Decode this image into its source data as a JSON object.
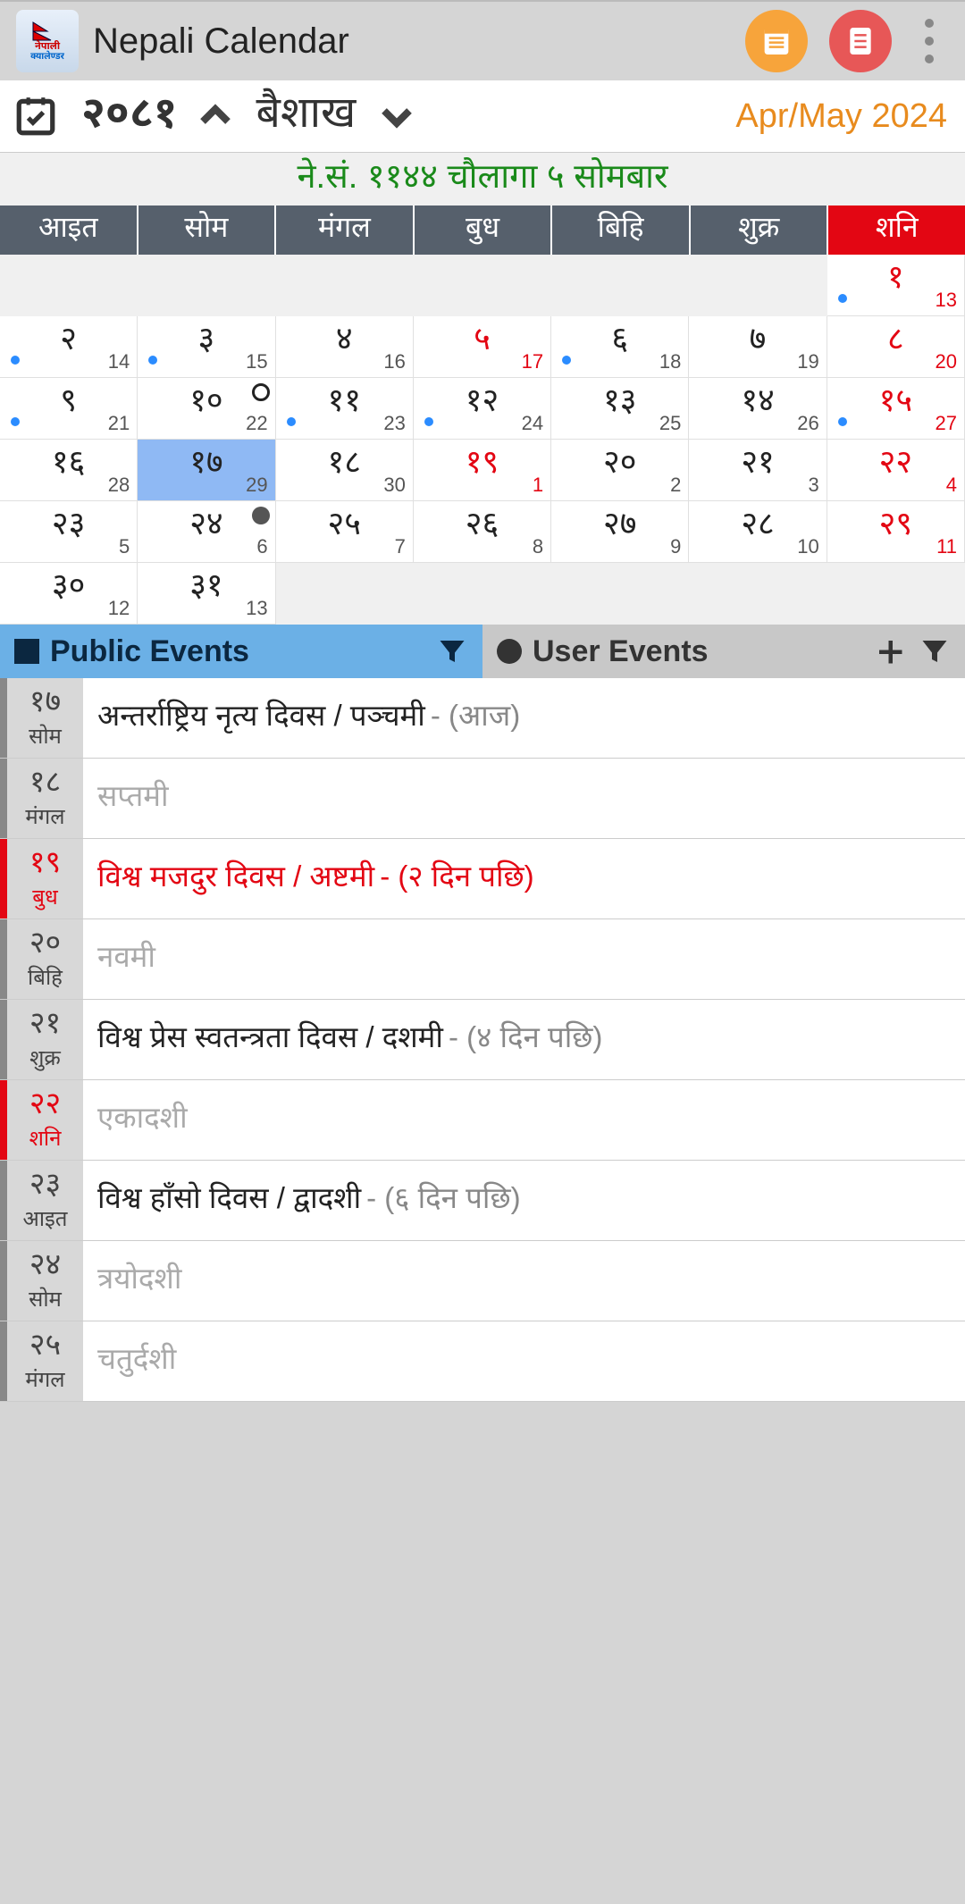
{
  "header": {
    "title": "Nepali Calendar"
  },
  "nav": {
    "year": "२०८१",
    "month": "बैशाख",
    "eng": "Apr/May 2024"
  },
  "subtitle": "ने.सं. ११४४ चौलागा ५ सोमबार",
  "weekdays": [
    "आइत",
    "सोम",
    "मंगल",
    "बुध",
    "बिहि",
    "शुक्र",
    "शनि"
  ],
  "rows": [
    [
      null,
      null,
      null,
      null,
      null,
      null,
      {
        "np": "१",
        "en": "13",
        "red": true,
        "dot": true
      }
    ],
    [
      {
        "np": "२",
        "en": "14",
        "dot": true
      },
      {
        "np": "३",
        "en": "15",
        "dot": true
      },
      {
        "np": "४",
        "en": "16"
      },
      {
        "np": "५",
        "en": "17",
        "red": true
      },
      {
        "np": "६",
        "en": "18",
        "dot": true
      },
      {
        "np": "७",
        "en": "19"
      },
      {
        "np": "८",
        "en": "20",
        "red": true
      }
    ],
    [
      {
        "np": "९",
        "en": "21",
        "dot": true
      },
      {
        "np": "१०",
        "en": "22",
        "moon": "open"
      },
      {
        "np": "११",
        "en": "23",
        "dot": true
      },
      {
        "np": "१२",
        "en": "24",
        "dot": true
      },
      {
        "np": "१३",
        "en": "25"
      },
      {
        "np": "१४",
        "en": "26"
      },
      {
        "np": "१५",
        "en": "27",
        "red": true,
        "dot": true
      }
    ],
    [
      {
        "np": "१६",
        "en": "28"
      },
      {
        "np": "१७",
        "en": "29",
        "today": true
      },
      {
        "np": "१८",
        "en": "30"
      },
      {
        "np": "१९",
        "en": "1",
        "red": true
      },
      {
        "np": "२०",
        "en": "2"
      },
      {
        "np": "२१",
        "en": "3"
      },
      {
        "np": "२२",
        "en": "4",
        "red": true
      }
    ],
    [
      {
        "np": "२३",
        "en": "5"
      },
      {
        "np": "२४",
        "en": "6",
        "moon": "full"
      },
      {
        "np": "२५",
        "en": "7"
      },
      {
        "np": "२६",
        "en": "8"
      },
      {
        "np": "२७",
        "en": "9"
      },
      {
        "np": "२८",
        "en": "10"
      },
      {
        "np": "२९",
        "en": "11",
        "red": true
      }
    ],
    [
      {
        "np": "३०",
        "en": "12"
      },
      {
        "np": "३१",
        "en": "13"
      },
      null,
      null,
      null,
      null,
      null
    ]
  ],
  "ev_header": {
    "public": "Public Events",
    "user": "User Events"
  },
  "events": [
    {
      "d": "१७",
      "w": "सोम",
      "red": false,
      "txt": "अन्तर्राष्ट्रिय नृत्य दिवस / पञ्चमी",
      "sfx": " - (आज)",
      "style": "bold"
    },
    {
      "d": "१८",
      "w": "मंगल",
      "red": false,
      "txt": "सप्तमी",
      "sfx": "",
      "style": "past"
    },
    {
      "d": "१९",
      "w": "बुध",
      "red": true,
      "txt": "विश्व मजदुर दिवस / अष्टमी",
      "sfx": " - (२ दिन पछि)",
      "style": "red"
    },
    {
      "d": "२०",
      "w": "बिहि",
      "red": false,
      "txt": "नवमी",
      "sfx": "",
      "style": "past"
    },
    {
      "d": "२१",
      "w": "शुक्र",
      "red": false,
      "txt": "विश्व प्रेस स्वतन्त्रता दिवस / दशमी",
      "sfx": " - (४ दिन पछि)",
      "style": "bold"
    },
    {
      "d": "२२",
      "w": "शनि",
      "red": true,
      "txt": "एकादशी",
      "sfx": "",
      "style": "past"
    },
    {
      "d": "२३",
      "w": "आइत",
      "red": false,
      "txt": "विश्व हाँसो दिवस / द्वादशी",
      "sfx": " - (६ दिन पछि)",
      "style": "bold"
    },
    {
      "d": "२४",
      "w": "सोम",
      "red": false,
      "txt": "त्रयोदशी",
      "sfx": "",
      "style": "past"
    },
    {
      "d": "२५",
      "w": "मंगल",
      "red": false,
      "txt": "चतुर्दशी",
      "sfx": "",
      "style": "past"
    }
  ]
}
